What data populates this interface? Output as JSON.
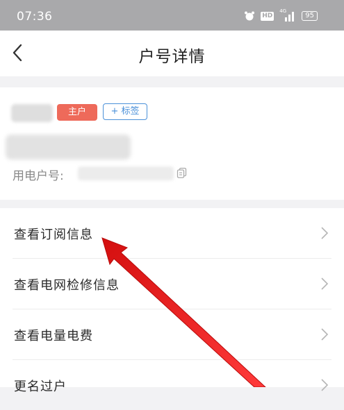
{
  "status_bar": {
    "time": "07:36",
    "hd_label": "HD",
    "network_label": "4G",
    "battery_level": "95"
  },
  "header": {
    "title": "户号详情",
    "back_icon": "chevron-left-icon"
  },
  "account": {
    "role_badge": "主户",
    "tag_button": "+ 标签",
    "account_no_label": "用电户号:",
    "copy_icon": "copy-icon"
  },
  "menu": {
    "items": [
      {
        "label": "查看订阅信息"
      },
      {
        "label": "查看电网检修信息"
      },
      {
        "label": "查看电量电费"
      },
      {
        "label": "更名过户"
      }
    ]
  },
  "colors": {
    "badge": "#ee6a5a",
    "tag_border": "#4a90d9",
    "annotation_arrow": "#e01818",
    "status_bar": "#a9a9ab"
  }
}
